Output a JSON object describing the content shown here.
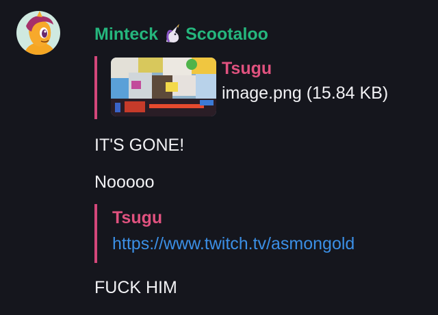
{
  "message": {
    "sender": "Minteck",
    "separator_icon": "unicorn-icon",
    "forwarded_from": "Scootaloo",
    "avatar_icon": "pony-avatar-icon",
    "reply_1": {
      "author": "Tsugu",
      "file_label": "image.png (15.84 KB)"
    },
    "lines": [
      "IT'S GONE!",
      "Nooooo",
      "FUCK HIM"
    ],
    "reply_2": {
      "author": "Tsugu",
      "link": "https://www.twitch.tv/asmongold"
    }
  },
  "colors": {
    "background": "#15161d",
    "sender": "#25b67d",
    "quote_bar": "#d4477a",
    "quote_author": "#e0527f",
    "link": "#3b8fe5",
    "text": "#f2f2f5"
  }
}
